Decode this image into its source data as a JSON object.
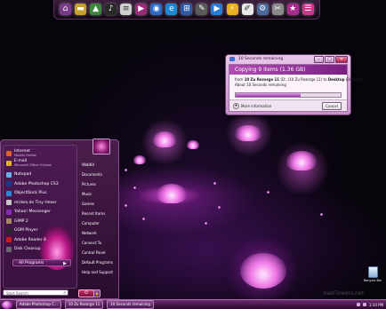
{
  "dock": {
    "icons": [
      "home-icon",
      "folder-icon",
      "picture-icon",
      "music-icon",
      "documents-icon",
      "media-player-icon",
      "globe-icon",
      "ie-icon",
      "windows-icon",
      "pen-icon",
      "play-icon",
      "lightning-icon",
      "notepad-icon",
      "settings-icon",
      "tools-icon",
      "favorites-icon",
      "clipboard-icon"
    ]
  },
  "copy_dialog": {
    "title": "10 Seconds remaining",
    "heading": "Copying 9 items (1.36 GB)",
    "from_label": "from",
    "from_source": "10 Zu Rezorge 11",
    "from_path": "(D:..\\10 Zu Rezorge 11)",
    "to_label": "to",
    "to_dest": "Desktop",
    "to_path": "(Desktop)",
    "about": "About 10 Seconds remaining",
    "progress": 0.62,
    "more_info": "More information",
    "cancel": "Cancel"
  },
  "start_menu": {
    "pinned": [
      {
        "label": "Internet",
        "sub": "Mozilla Firefox",
        "color": "#e06020"
      },
      {
        "label": "E-mail",
        "sub": "Microsoft Office Outlook",
        "color": "#e0b020"
      }
    ],
    "recent": [
      {
        "label": "Notepad",
        "color": "#6ab0e8"
      },
      {
        "label": "Adobe Photoshop CS3",
        "color": "#1a3a8a"
      },
      {
        "label": "ObjectDock Plus",
        "color": "#2a8ad8"
      },
      {
        "label": "mirkes.de Tiny Hexer",
        "color": "#c8c8c8"
      },
      {
        "label": "Yahoo! Messenger",
        "color": "#8a2ab8"
      },
      {
        "label": "GIMP 2",
        "color": "#a08a60"
      },
      {
        "label": "GOM Player",
        "color": "#2a2a2a"
      },
      {
        "label": "Adobe Reader 8",
        "color": "#c81a1a"
      },
      {
        "label": "Disk Cleanup",
        "color": "#6a6a6a"
      }
    ],
    "all_programs": "All Programs",
    "search_placeholder": "Start Search",
    "right_items": [
      "WebKit",
      "Documents",
      "Pictures",
      "Music",
      "Games",
      "Recent Items",
      "Computer",
      "Network",
      "Connect To",
      "Control Panel",
      "Default Programs",
      "Help and Support"
    ]
  },
  "taskbar": {
    "buttons": [
      "Adobe Photoshop C...",
      "10 Zu Rezorge 11",
      "10 Seconds remaining"
    ],
    "clock": "1:10 PM"
  },
  "desktop": {
    "recycle_bin": "Recycle Bin",
    "watermark": "kasFlowers.net"
  }
}
